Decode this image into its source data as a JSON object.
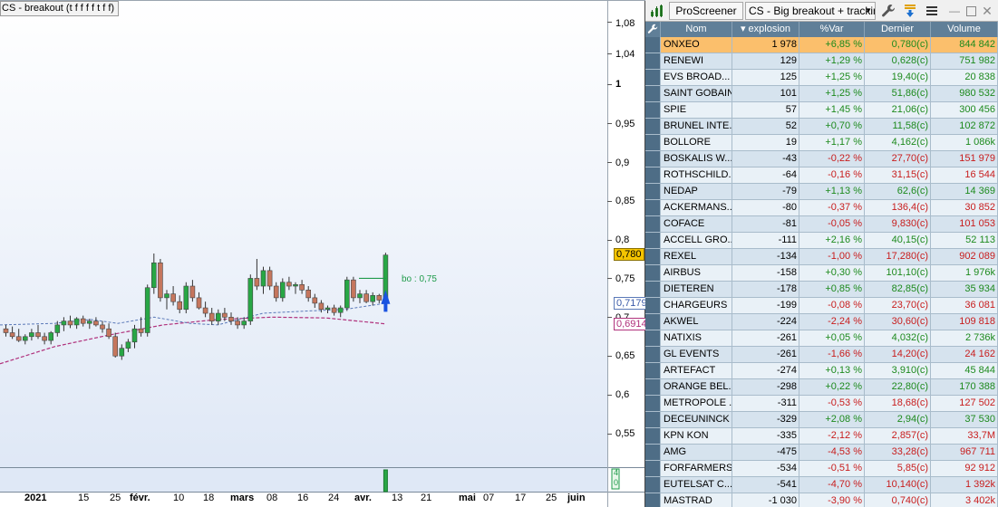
{
  "chart": {
    "title": "CS - breakout (t f f f f t f f)",
    "breakout_label": "bo : 0,75",
    "price_axis": [
      "1,08",
      "1,04",
      "1",
      "0,95",
      "0,9",
      "0,85",
      "0,8",
      "0,75",
      "0,7",
      "0,65",
      "0,6",
      "0,55"
    ],
    "price_tags": {
      "last": "0,780",
      "ma_short": "0,7179",
      "ma_long": "0,6914"
    },
    "date_axis": [
      "2021",
      "15",
      "25",
      "févr.",
      "10",
      "18",
      "mars",
      "08",
      "16",
      "24",
      "avr.",
      "13",
      "21",
      "mai",
      "07",
      "17",
      "25",
      "juin"
    ],
    "volume_axis": [
      "4",
      "0"
    ],
    "colors": {
      "background": "#ffffff",
      "candle_up": "#28a745",
      "candle_down": "#c5765d",
      "ma_short": "#5a79b8",
      "ma_long": "#b0317c",
      "last_tag_bg": "#f5c400",
      "breakout_line": "#1f9b4b",
      "arrow": "#1a53e0"
    }
  },
  "chart_data": {
    "type": "candlestick",
    "title": "CS - breakout (t f f f f t f f)",
    "ylim": [
      0.525,
      1.1
    ],
    "y_ticks": [
      1.08,
      1.04,
      1,
      0.95,
      0.9,
      0.85,
      0.8,
      0.75,
      0.7,
      0.65,
      0.6,
      0.55
    ],
    "last_close": 0.78,
    "ma_short_last": 0.7179,
    "ma_long_last": 0.6914,
    "breakout_level": 0.75,
    "series": [
      {
        "name": "price",
        "values": [
          [
            0.685,
            0.69,
            0.675,
            0.68
          ],
          [
            0.68,
            0.688,
            0.672,
            0.675
          ],
          [
            0.675,
            0.685,
            0.668,
            0.67
          ],
          [
            0.67,
            0.678,
            0.665,
            0.675
          ],
          [
            0.675,
            0.685,
            0.67,
            0.68
          ],
          [
            0.68,
            0.69,
            0.672,
            0.675
          ],
          [
            0.675,
            0.68,
            0.665,
            0.67
          ],
          [
            0.67,
            0.682,
            0.665,
            0.68
          ],
          [
            0.68,
            0.695,
            0.675,
            0.69
          ],
          [
            0.69,
            0.7,
            0.682,
            0.695
          ],
          [
            0.695,
            0.702,
            0.686,
            0.69
          ],
          [
            0.69,
            0.7,
            0.685,
            0.698
          ],
          [
            0.698,
            0.702,
            0.688,
            0.692
          ],
          [
            0.692,
            0.698,
            0.685,
            0.695
          ],
          [
            0.695,
            0.7,
            0.688,
            0.69
          ],
          [
            0.69,
            0.695,
            0.68,
            0.685
          ],
          [
            0.685,
            0.692,
            0.672,
            0.675
          ],
          [
            0.675,
            0.68,
            0.648,
            0.65
          ],
          [
            0.65,
            0.665,
            0.645,
            0.66
          ],
          [
            0.66,
            0.672,
            0.655,
            0.668
          ],
          [
            0.668,
            0.69,
            0.66,
            0.685
          ],
          [
            0.685,
            0.7,
            0.675,
            0.68
          ],
          [
            0.68,
            0.742,
            0.675,
            0.738
          ],
          [
            0.738,
            0.782,
            0.73,
            0.77
          ],
          [
            0.77,
            0.775,
            0.72,
            0.725
          ],
          [
            0.725,
            0.735,
            0.71,
            0.73
          ],
          [
            0.73,
            0.74,
            0.715,
            0.72
          ],
          [
            0.72,
            0.728,
            0.705,
            0.71
          ],
          [
            0.71,
            0.745,
            0.705,
            0.74
          ],
          [
            0.74,
            0.748,
            0.72,
            0.725
          ],
          [
            0.725,
            0.732,
            0.71,
            0.712
          ],
          [
            0.712,
            0.72,
            0.7,
            0.705
          ],
          [
            0.705,
            0.712,
            0.69,
            0.695
          ],
          [
            0.695,
            0.71,
            0.69,
            0.705
          ],
          [
            0.705,
            0.712,
            0.695,
            0.7
          ],
          [
            0.7,
            0.706,
            0.69,
            0.695
          ],
          [
            0.695,
            0.7,
            0.685,
            0.69
          ],
          [
            0.69,
            0.7,
            0.685,
            0.695
          ],
          [
            0.695,
            0.755,
            0.69,
            0.75
          ],
          [
            0.75,
            0.775,
            0.735,
            0.74
          ],
          [
            0.74,
            0.765,
            0.73,
            0.76
          ],
          [
            0.76,
            0.765,
            0.735,
            0.74
          ],
          [
            0.74,
            0.745,
            0.72,
            0.725
          ],
          [
            0.725,
            0.75,
            0.72,
            0.745
          ],
          [
            0.745,
            0.752,
            0.735,
            0.74
          ],
          [
            0.74,
            0.745,
            0.73,
            0.742
          ],
          [
            0.742,
            0.748,
            0.73,
            0.735
          ],
          [
            0.735,
            0.74,
            0.72,
            0.725
          ],
          [
            0.725,
            0.73,
            0.712,
            0.718
          ],
          [
            0.718,
            0.722,
            0.706,
            0.71
          ],
          [
            0.71,
            0.715,
            0.705,
            0.712
          ],
          [
            0.712,
            0.716,
            0.702,
            0.706
          ],
          [
            0.706,
            0.715,
            0.7,
            0.712
          ],
          [
            0.712,
            0.752,
            0.708,
            0.748
          ],
          [
            0.748,
            0.752,
            0.72,
            0.725
          ],
          [
            0.725,
            0.735,
            0.718,
            0.73
          ],
          [
            0.73,
            0.735,
            0.718,
            0.72
          ],
          [
            0.72,
            0.732,
            0.715,
            0.728
          ],
          [
            0.728,
            0.73,
            0.718,
            0.722
          ],
          [
            0.722,
            0.783,
            0.72,
            0.78
          ]
        ]
      }
    ]
  },
  "screener": {
    "toolbar": {
      "title": "ProScreener",
      "selected_screen": "CS - Big breakout + tracking",
      "icons": [
        "screener-icon",
        "wrench-icon",
        "sort-arrow-icon",
        "menu-icon",
        "minimize-icon",
        "maximize-icon",
        "close-icon"
      ]
    },
    "columns": [
      "Nom",
      "explosion",
      "%Var",
      "Dernier",
      "Volume"
    ],
    "sort_indicator": "▾",
    "rows": [
      {
        "nom": "ONXEO",
        "explosion": "1 978",
        "var": "+6,85 %",
        "dernier": "0,780(c)",
        "volume": "844 842"
      },
      {
        "nom": "RENEWI",
        "explosion": "129",
        "var": "+1,29 %",
        "dernier": "0,628(c)",
        "volume": "751 982"
      },
      {
        "nom": "EVS BROAD...",
        "explosion": "125",
        "var": "+1,25 %",
        "dernier": "19,40(c)",
        "volume": "20 838"
      },
      {
        "nom": "SAINT GOBAIN",
        "explosion": "101",
        "var": "+1,25 %",
        "dernier": "51,86(c)",
        "volume": "980 532"
      },
      {
        "nom": "SPIE",
        "explosion": "57",
        "var": "+1,45 %",
        "dernier": "21,06(c)",
        "volume": "300 456"
      },
      {
        "nom": "BRUNEL INTE...",
        "explosion": "52",
        "var": "+0,70 %",
        "dernier": "11,58(c)",
        "volume": "102 872"
      },
      {
        "nom": "BOLLORE",
        "explosion": "19",
        "var": "+1,17 %",
        "dernier": "4,162(c)",
        "volume": "1 086k"
      },
      {
        "nom": "BOSKALIS W...",
        "explosion": "-43",
        "var": "-0,22 %",
        "dernier": "27,70(c)",
        "volume": "151 979"
      },
      {
        "nom": "ROTHSCHILD...",
        "explosion": "-64",
        "var": "-0,16 %",
        "dernier": "31,15(c)",
        "volume": "16 544"
      },
      {
        "nom": "NEDAP",
        "explosion": "-79",
        "var": "+1,13 %",
        "dernier": "62,6(c)",
        "volume": "14 369"
      },
      {
        "nom": "ACKERMANS...",
        "explosion": "-80",
        "var": "-0,37 %",
        "dernier": "136,4(c)",
        "volume": "30 852"
      },
      {
        "nom": "COFACE",
        "explosion": "-81",
        "var": "-0,05 %",
        "dernier": "9,830(c)",
        "volume": "101 053"
      },
      {
        "nom": "ACCELL GRO...",
        "explosion": "-111",
        "var": "+2,16 %",
        "dernier": "40,15(c)",
        "volume": "52 113"
      },
      {
        "nom": "REXEL",
        "explosion": "-134",
        "var": "-1,00 %",
        "dernier": "17,280(c)",
        "volume": "902 089"
      },
      {
        "nom": "AIRBUS",
        "explosion": "-158",
        "var": "+0,30 %",
        "dernier": "101,10(c)",
        "volume": "1 976k"
      },
      {
        "nom": "DIETEREN",
        "explosion": "-178",
        "var": "+0,85 %",
        "dernier": "82,85(c)",
        "volume": "35 934"
      },
      {
        "nom": "CHARGEURS",
        "explosion": "-199",
        "var": "-0,08 %",
        "dernier": "23,70(c)",
        "volume": "36 081"
      },
      {
        "nom": "AKWEL",
        "explosion": "-224",
        "var": "-2,24 %",
        "dernier": "30,60(c)",
        "volume": "109 818"
      },
      {
        "nom": "NATIXIS",
        "explosion": "-261",
        "var": "+0,05 %",
        "dernier": "4,032(c)",
        "volume": "2 736k"
      },
      {
        "nom": "GL EVENTS",
        "explosion": "-261",
        "var": "-1,66 %",
        "dernier": "14,20(c)",
        "volume": "24 162"
      },
      {
        "nom": "ARTEFACT",
        "explosion": "-274",
        "var": "+0,13 %",
        "dernier": "3,910(c)",
        "volume": "45 844"
      },
      {
        "nom": "ORANGE BEL...",
        "explosion": "-298",
        "var": "+0,22 %",
        "dernier": "22,80(c)",
        "volume": "170 388"
      },
      {
        "nom": "METROPOLE ...",
        "explosion": "-311",
        "var": "-0,53 %",
        "dernier": "18,68(c)",
        "volume": "127 502"
      },
      {
        "nom": "DECEUNINCK",
        "explosion": "-329",
        "var": "+2,08 %",
        "dernier": "2,94(c)",
        "volume": "37 530"
      },
      {
        "nom": "KPN KON",
        "explosion": "-335",
        "var": "-2,12 %",
        "dernier": "2,857(c)",
        "volume": "33,7M"
      },
      {
        "nom": "AMG",
        "explosion": "-475",
        "var": "-4,53 %",
        "dernier": "33,28(c)",
        "volume": "967 711"
      },
      {
        "nom": "FORFARMERS",
        "explosion": "-534",
        "var": "-0,51 %",
        "dernier": "5,85(c)",
        "volume": "92 912"
      },
      {
        "nom": "EUTELSAT C...",
        "explosion": "-541",
        "var": "-4,70 %",
        "dernier": "10,140(c)",
        "volume": "1 392k"
      },
      {
        "nom": "MASTRAD",
        "explosion": "-1 030",
        "var": "-3,90 %",
        "dernier": "0,740(c)",
        "volume": "3 402k"
      }
    ],
    "colors": {
      "selected_row": "#fbbf6c",
      "positive": "#1d8a1d",
      "negative": "#c81d1d",
      "header_bg": "#607f98"
    }
  }
}
